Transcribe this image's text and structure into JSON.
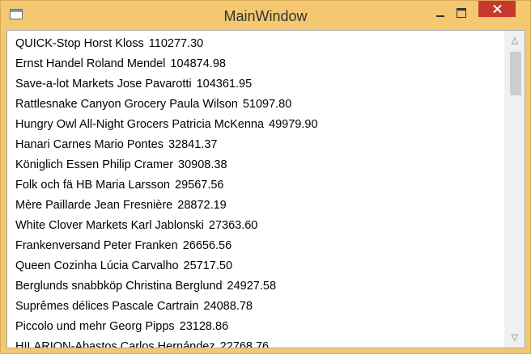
{
  "window": {
    "title": "MainWindow"
  },
  "icons": {
    "app": "window-icon",
    "minimize": "minimize-icon",
    "maximize": "maximize-icon",
    "close": "close-icon",
    "scroll_up": "chevron-up-icon",
    "scroll_down": "chevron-down-icon"
  },
  "colors": {
    "titlebar": "#f4c870",
    "close_button": "#c7382d"
  },
  "list": {
    "items": [
      {
        "company": "QUICK-Stop",
        "contact": "Horst Kloss",
        "amount": "110277.30"
      },
      {
        "company": "Ernst Handel",
        "contact": "Roland Mendel",
        "amount": "104874.98"
      },
      {
        "company": "Save-a-lot Markets",
        "contact": "Jose Pavarotti",
        "amount": "104361.95"
      },
      {
        "company": "Rattlesnake Canyon Grocery",
        "contact": "Paula Wilson",
        "amount": "51097.80"
      },
      {
        "company": "Hungry Owl All-Night Grocers",
        "contact": "Patricia McKenna",
        "amount": "49979.90"
      },
      {
        "company": "Hanari Carnes",
        "contact": "Mario Pontes",
        "amount": "32841.37"
      },
      {
        "company": "Königlich Essen",
        "contact": "Philip Cramer",
        "amount": "30908.38"
      },
      {
        "company": "Folk och fä HB",
        "contact": "Maria Larsson",
        "amount": "29567.56"
      },
      {
        "company": "Mère Paillarde",
        "contact": "Jean Fresnière",
        "amount": "28872.19"
      },
      {
        "company": "White Clover Markets",
        "contact": "Karl Jablonski",
        "amount": "27363.60"
      },
      {
        "company": "Frankenversand",
        "contact": "Peter Franken",
        "amount": "26656.56"
      },
      {
        "company": "Queen Cozinha",
        "contact": "Lúcia Carvalho",
        "amount": "25717.50"
      },
      {
        "company": "Berglunds snabbköp",
        "contact": "Christina Berglund",
        "amount": "24927.58"
      },
      {
        "company": "Suprêmes délices",
        "contact": "Pascale Cartrain",
        "amount": "24088.78"
      },
      {
        "company": "Piccolo und mehr",
        "contact": "Georg Pipps",
        "amount": "23128.86"
      },
      {
        "company": "HILARION-Abastos",
        "contact": "Carlos Hernández",
        "amount": "22768.76"
      }
    ]
  }
}
